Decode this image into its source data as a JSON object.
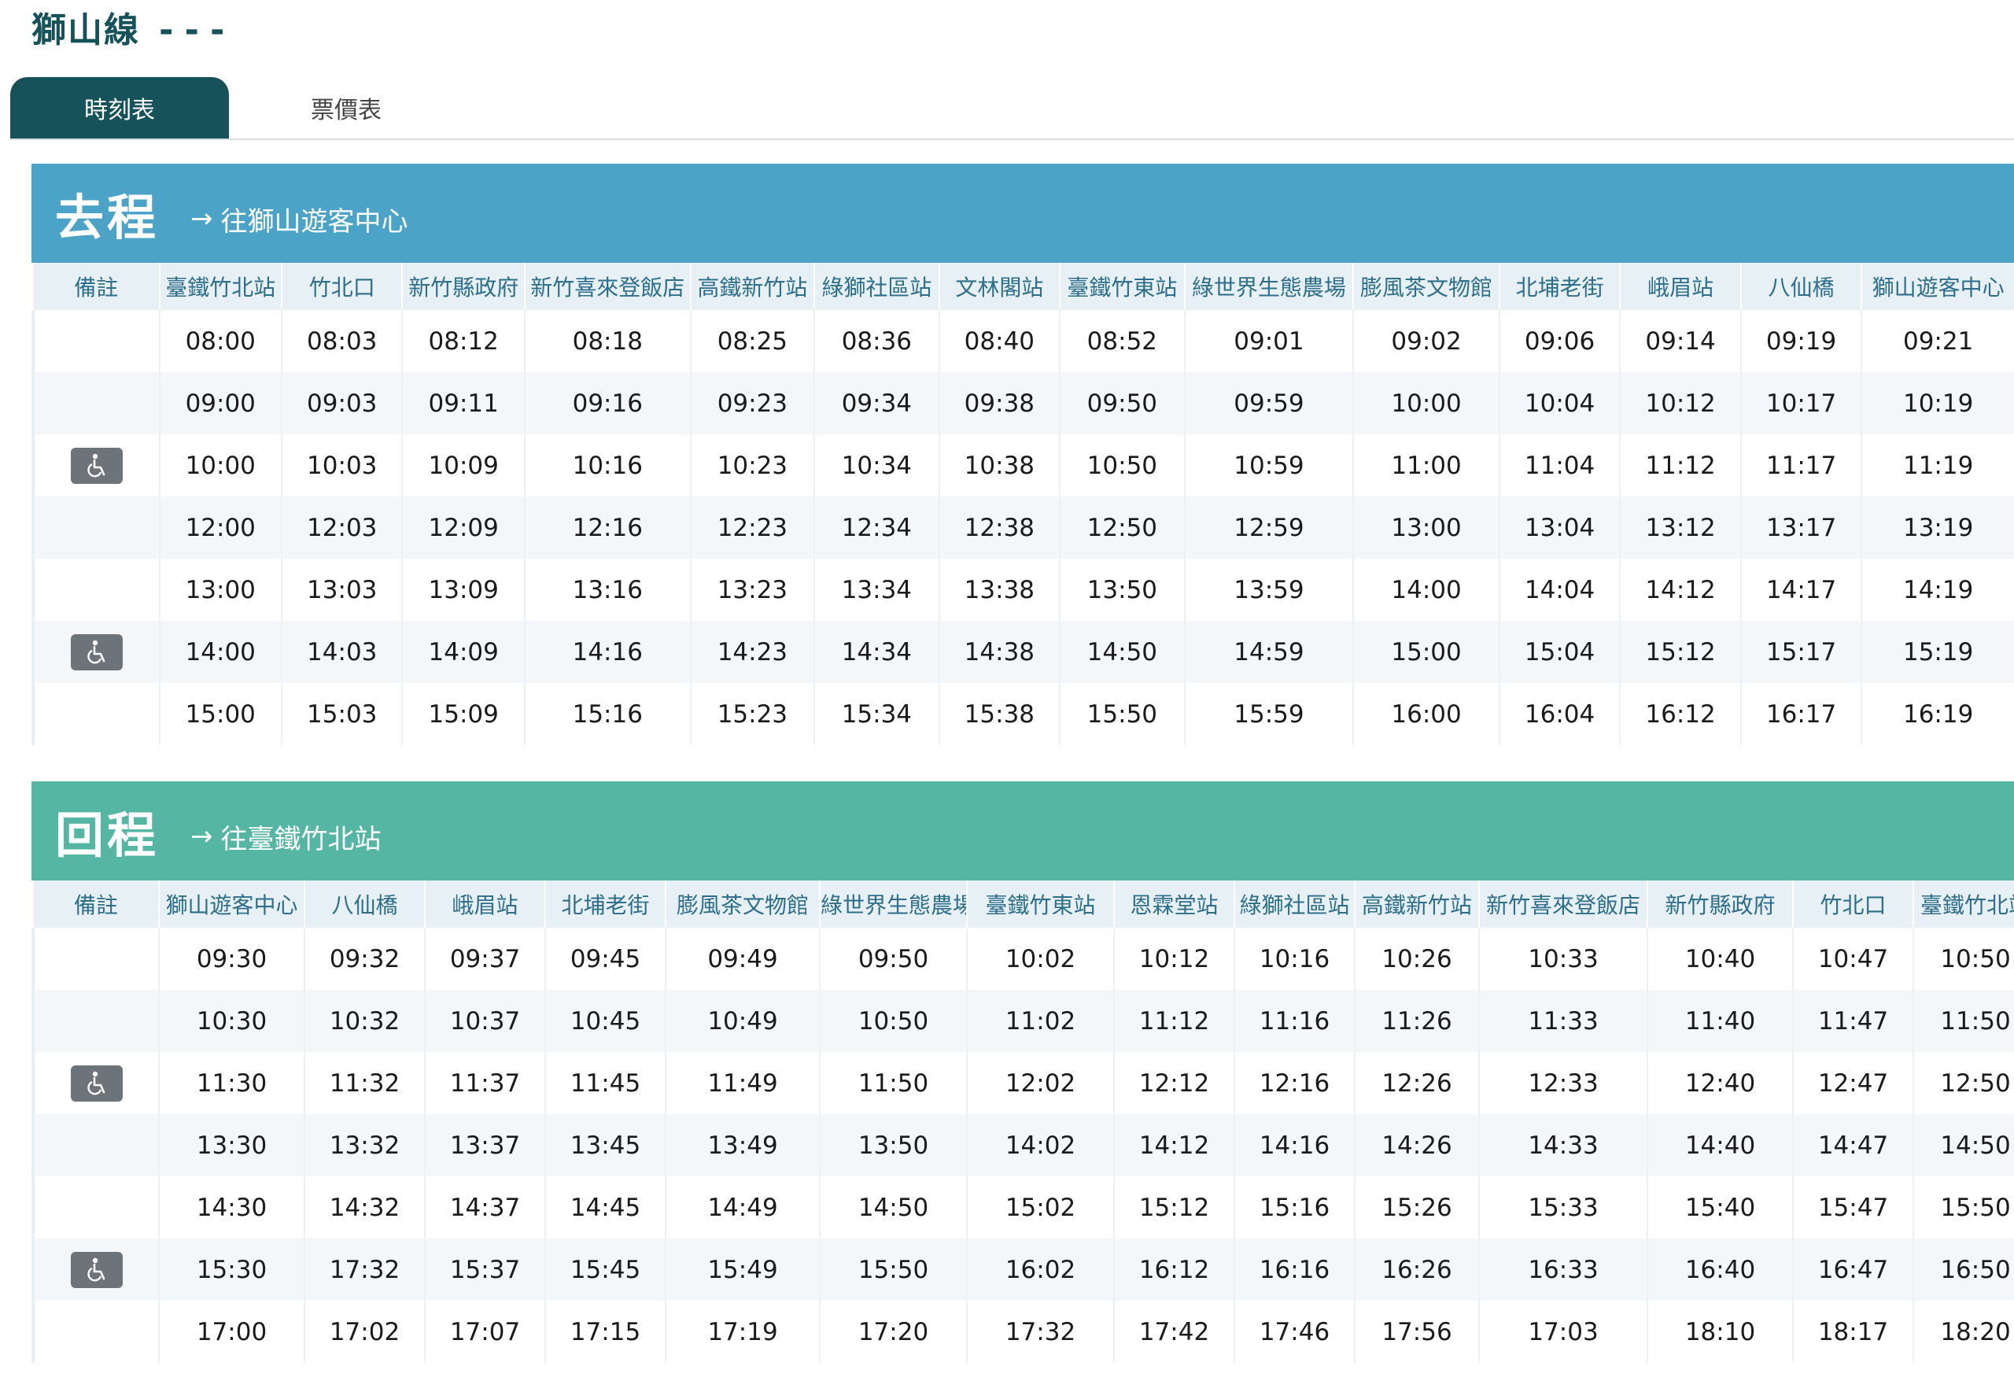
{
  "page": {
    "title": "獅山線",
    "title_suffix": "---"
  },
  "tabs": [
    {
      "label": "時刻表",
      "active": true
    },
    {
      "label": "票價表",
      "active": false
    }
  ],
  "icons": {
    "accessible": "wheelchair-icon",
    "arrow": "arrow-right-icon"
  },
  "colors": {
    "outbound": "#4ba3c7",
    "inbound": "#55b7a3",
    "tab_active": "#16525a"
  },
  "outbound": {
    "direction": "去程",
    "arrow": "→",
    "destination": "往獅山遊客中心",
    "columns": [
      "備註",
      "臺鐵竹北站",
      "竹北口",
      "新竹縣政府",
      "新竹喜來登飯店",
      "高鐵新竹站",
      "綠獅社區站",
      "文林閣站",
      "臺鐵竹東站",
      "綠世界生態農場",
      "膨風茶文物館",
      "北埔老街",
      "峨眉站",
      "八仙橋",
      "獅山遊客中心"
    ],
    "rows": [
      {
        "accessible": false,
        "times": [
          "08:00",
          "08:03",
          "08:12",
          "08:18",
          "08:25",
          "08:36",
          "08:40",
          "08:52",
          "09:01",
          "09:02",
          "09:06",
          "09:14",
          "09:19",
          "09:21"
        ]
      },
      {
        "accessible": false,
        "times": [
          "09:00",
          "09:03",
          "09:11",
          "09:16",
          "09:23",
          "09:34",
          "09:38",
          "09:50",
          "09:59",
          "10:00",
          "10:04",
          "10:12",
          "10:17",
          "10:19"
        ]
      },
      {
        "accessible": true,
        "times": [
          "10:00",
          "10:03",
          "10:09",
          "10:16",
          "10:23",
          "10:34",
          "10:38",
          "10:50",
          "10:59",
          "11:00",
          "11:04",
          "11:12",
          "11:17",
          "11:19"
        ]
      },
      {
        "accessible": false,
        "times": [
          "12:00",
          "12:03",
          "12:09",
          "12:16",
          "12:23",
          "12:34",
          "12:38",
          "12:50",
          "12:59",
          "13:00",
          "13:04",
          "13:12",
          "13:17",
          "13:19"
        ]
      },
      {
        "accessible": false,
        "times": [
          "13:00",
          "13:03",
          "13:09",
          "13:16",
          "13:23",
          "13:34",
          "13:38",
          "13:50",
          "13:59",
          "14:00",
          "14:04",
          "14:12",
          "14:17",
          "14:19"
        ]
      },
      {
        "accessible": true,
        "times": [
          "14:00",
          "14:03",
          "14:09",
          "14:16",
          "14:23",
          "14:34",
          "14:38",
          "14:50",
          "14:59",
          "15:00",
          "15:04",
          "15:12",
          "15:17",
          "15:19"
        ]
      },
      {
        "accessible": false,
        "times": [
          "15:00",
          "15:03",
          "15:09",
          "15:16",
          "15:23",
          "15:34",
          "15:38",
          "15:50",
          "15:59",
          "16:00",
          "16:04",
          "16:12",
          "16:17",
          "16:19"
        ]
      }
    ]
  },
  "inbound": {
    "direction": "回程",
    "arrow": "→",
    "destination": "往臺鐵竹北站",
    "columns": [
      "備註",
      "獅山遊客中心",
      "八仙橋",
      "峨眉站",
      "北埔老街",
      "膨風茶文物館",
      "綠世界生態農場",
      "臺鐵竹東站",
      "恩霖堂站",
      "綠獅社區站",
      "高鐵新竹站",
      "新竹喜來登飯店",
      "新竹縣政府",
      "竹北口",
      "臺鐵竹北站"
    ],
    "rows": [
      {
        "accessible": false,
        "times": [
          "09:30",
          "09:32",
          "09:37",
          "09:45",
          "09:49",
          "09:50",
          "10:02",
          "10:12",
          "10:16",
          "10:26",
          "10:33",
          "10:40",
          "10:47",
          "10:50"
        ]
      },
      {
        "accessible": false,
        "times": [
          "10:30",
          "10:32",
          "10:37",
          "10:45",
          "10:49",
          "10:50",
          "11:02",
          "11:12",
          "11:16",
          "11:26",
          "11:33",
          "11:40",
          "11:47",
          "11:50"
        ]
      },
      {
        "accessible": true,
        "times": [
          "11:30",
          "11:32",
          "11:37",
          "11:45",
          "11:49",
          "11:50",
          "12:02",
          "12:12",
          "12:16",
          "12:26",
          "12:33",
          "12:40",
          "12:47",
          "12:50"
        ]
      },
      {
        "accessible": false,
        "times": [
          "13:30",
          "13:32",
          "13:37",
          "13:45",
          "13:49",
          "13:50",
          "14:02",
          "14:12",
          "14:16",
          "14:26",
          "14:33",
          "14:40",
          "14:47",
          "14:50"
        ]
      },
      {
        "accessible": false,
        "times": [
          "14:30",
          "14:32",
          "14:37",
          "14:45",
          "14:49",
          "14:50",
          "15:02",
          "15:12",
          "15:16",
          "15:26",
          "15:33",
          "15:40",
          "15:47",
          "15:50"
        ]
      },
      {
        "accessible": true,
        "times": [
          "15:30",
          "17:32",
          "15:37",
          "15:45",
          "15:49",
          "15:50",
          "16:02",
          "16:12",
          "16:16",
          "16:26",
          "16:33",
          "16:40",
          "16:47",
          "16:50"
        ]
      },
      {
        "accessible": false,
        "times": [
          "17:00",
          "17:02",
          "17:07",
          "17:15",
          "17:19",
          "17:20",
          "17:32",
          "17:42",
          "17:46",
          "17:56",
          "17:03",
          "18:10",
          "18:17",
          "18:20"
        ]
      }
    ]
  }
}
